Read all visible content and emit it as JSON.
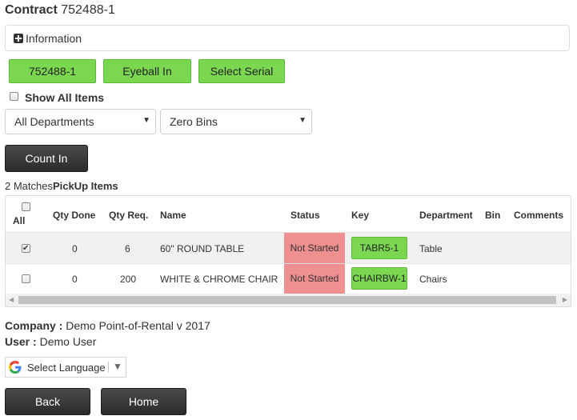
{
  "header": {
    "title_label": "Contract",
    "contract_number": "752488-1"
  },
  "info_panel": {
    "label": "Information",
    "icon": "plus-square-icon"
  },
  "action_buttons": {
    "contract": "752488-1",
    "eyeball_in": "Eyeball In",
    "select_serial": "Select Serial"
  },
  "show_all": {
    "label": "Show All Items",
    "checked": false
  },
  "filters": {
    "department": {
      "selected": "All Departments"
    },
    "bins": {
      "selected": "Zero Bins"
    }
  },
  "count_in_label": "Count In",
  "matches": {
    "count_text": "2 Matches",
    "section_title": "PickUp Items"
  },
  "table": {
    "columns": {
      "all": "All",
      "qty_done": "Qty Done",
      "qty_req": "Qty Req.",
      "name": "Name",
      "status": "Status",
      "key": "Key",
      "department": "Department",
      "bin": "Bin",
      "comments": "Comments"
    },
    "rows": [
      {
        "checked": true,
        "qty_done": "0",
        "qty_req": "6",
        "name": "60\" ROUND TABLE",
        "status": "Not Started",
        "key": "TABR5-1",
        "department": "Table",
        "bin": "",
        "comments": ""
      },
      {
        "checked": false,
        "qty_done": "0",
        "qty_req": "200",
        "name": "WHITE & CHROME CHAIR",
        "status": "Not Started",
        "key": "CHAIRBW-1",
        "department": "Chairs",
        "bin": "",
        "comments": ""
      }
    ]
  },
  "footer": {
    "company_label": "Company :",
    "company_value": "Demo Point-of-Rental v 2017",
    "user_label": "User :",
    "user_value": "Demo User",
    "language_label": "Select Language"
  },
  "nav": {
    "back": "Back",
    "home": "Home"
  },
  "colors": {
    "green_button": "#7bd650",
    "status_not_started": "#f08f8f",
    "dark_button": "#2b2b2b"
  }
}
